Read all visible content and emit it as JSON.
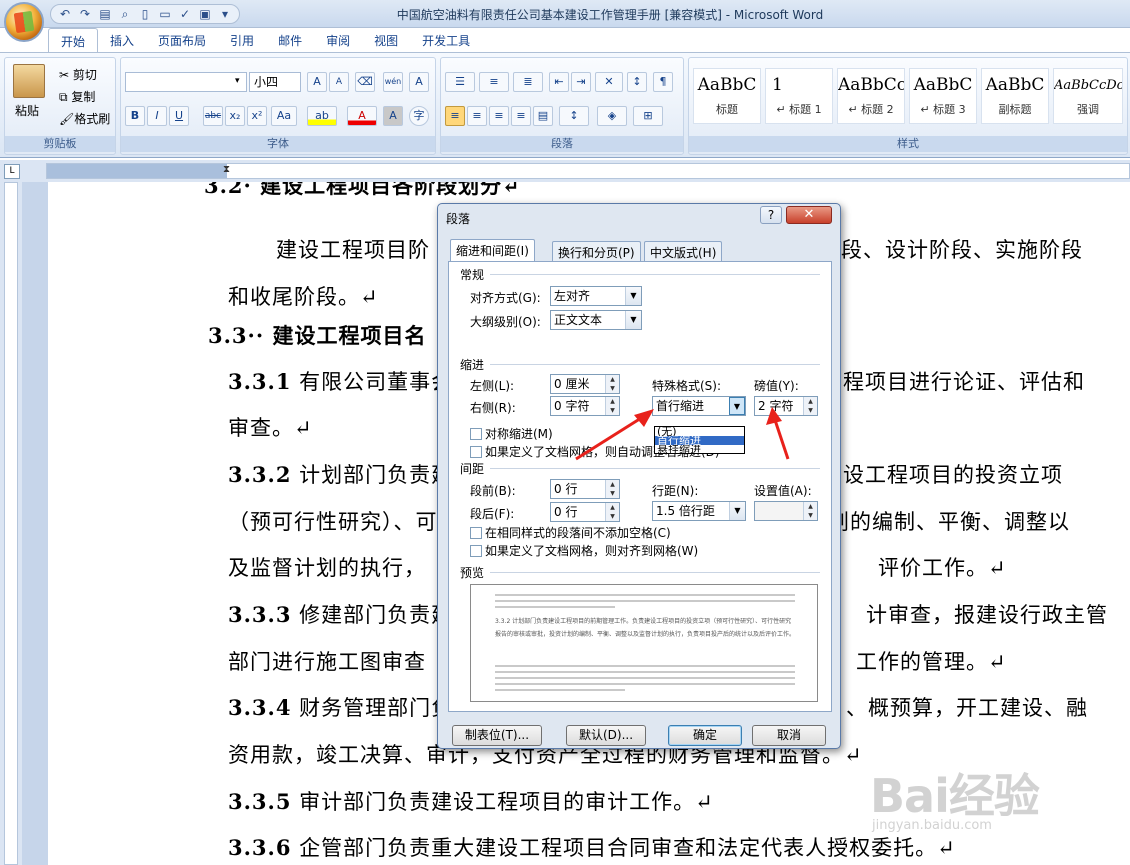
{
  "window": {
    "title": "中国航空油料有限责任公司基本建设工作管理手册 [兼容模式] - Microsoft Word",
    "qat_icons": [
      "undo-icon",
      "redo-icon",
      "print-icon",
      "preview-icon",
      "new-icon",
      "open-icon",
      "spell-icon",
      "save-icon"
    ]
  },
  "tabs": [
    "开始",
    "插入",
    "页面布局",
    "引用",
    "邮件",
    "审阅",
    "视图",
    "开发工具"
  ],
  "ribbon": {
    "clipboard": {
      "label": "剪贴板",
      "paste": "粘贴",
      "cut": "剪切",
      "copy": "复制",
      "format_painter": "格式刷"
    },
    "font": {
      "label": "字体",
      "font_name": "",
      "font_size": "小四",
      "bold": "B",
      "italic": "I",
      "underline": "U",
      "strike": "abc",
      "subscript": "x₂",
      "superscript": "x²",
      "case": "Aa",
      "grow": "A",
      "shrink": "A",
      "phonetic": "wén",
      "char_border": "A"
    },
    "paragraph": {
      "label": "段落"
    },
    "styles": {
      "label": "样式",
      "items": [
        {
          "preview": "AaBbC",
          "name": "标题"
        },
        {
          "preview": "1",
          "name": "↵ 标题 1"
        },
        {
          "preview": "AaBbCc",
          "name": "↵ 标题 2"
        },
        {
          "preview": "AaBbC",
          "name": "↵ 标题 3"
        },
        {
          "preview": "AaBbC",
          "name": "副标题"
        },
        {
          "preview": "AaBbCcDc",
          "name": "强调"
        }
      ]
    }
  },
  "document": {
    "heading_32": "3.2· 建设工程项目各阶段划分↵",
    "para_32_a": "建设工程项目阶",
    "para_32_b": "段、设计阶段、实施阶段",
    "para_32_c": "和收尾阶段。↵",
    "heading_33": "3.3·· 建设工程项目名",
    "items": [
      {
        "num": "3.3.1",
        "a": "有限公司董事会",
        "b": "程项目进行论证、评估和",
        "c": "审查。↵"
      },
      {
        "num": "3.3.2",
        "a": "计划部门负责建",
        "b": "设工程项目的投资立项",
        "c": "（预可行性研究）、可",
        "d": "划的编制、平衡、调整以",
        "e": "及监督计划的执行，",
        "f": "评价工作。↵"
      },
      {
        "num": "3.3.3",
        "a": "修建部门负责建",
        "b": "计审查，报建设行政主管",
        "c": "部门进行施工图审查",
        "d": "工作的管理。↵"
      },
      {
        "num": "3.3.4",
        "a": "财务管理部门负",
        "b": "、概预算，开工建设、融",
        "c": "资用款，竣工决算、审计，支付资产全过程的财务管理和监督。↵"
      },
      {
        "num": "3.3.5",
        "a": "审计部门负责建设工程项目的审计工作。↵"
      },
      {
        "num": "3.3.6",
        "a": "企管部门负责重大建设工程项目合同审查和法定代表人授权委托。↵"
      }
    ]
  },
  "dialog": {
    "title": "段落",
    "help": "?",
    "close": "✕",
    "tabs": [
      "缩进和间距(I)",
      "换行和分页(P)",
      "中文版式(H)"
    ],
    "general": {
      "section": "常规",
      "alignment_label": "对齐方式(G):",
      "alignment_value": "左对齐",
      "outline_label": "大纲级别(O):",
      "outline_value": "正文文本"
    },
    "indent": {
      "section": "缩进",
      "left_label": "左侧(L):",
      "left_value": "0 厘米",
      "right_label": "右侧(R):",
      "right_value": "0 字符",
      "special_label": "特殊格式(S):",
      "special_value": "首行缩进",
      "by_label": "磅值(Y):",
      "by_value": "2 字符",
      "mirror": "对称缩进(M)",
      "auto_adjust": "如果定义了文档网格，则自动调整右缩进(D)",
      "options": [
        "(无)",
        "首行缩进",
        "悬挂缩进"
      ],
      "selected_option": "首行缩进"
    },
    "spacing": {
      "section": "间距",
      "before_label": "段前(B):",
      "before_value": "0 行",
      "after_label": "段后(F):",
      "after_value": "0 行",
      "line_label": "行距(N):",
      "line_value": "1.5 倍行距",
      "at_label": "设置值(A):",
      "at_value": "",
      "no_space": "在相同样式的段落间不添加空格(C)",
      "snap_grid": "如果定义了文档网格，则对齐到网格(W)"
    },
    "preview": {
      "section": "预览",
      "sample_text": "3.3.2 计划部门负责建设工程项目的前期管理工作。负责建设工程项目的投资立项（预可行性研究）、可行性研究报告的审核或审批，投资计划的编制、平衡、调整以及监督计划的执行，负责项目投产后的统计以及后评价工作。"
    },
    "buttons": {
      "tabs": "制表位(T)...",
      "default": "默认(D)...",
      "ok": "确定",
      "cancel": "取消"
    }
  },
  "watermark": {
    "logo": "Bai经验",
    "url": "jingyan.baidu.com"
  },
  "colors": {
    "ribbon_text": "#15428b",
    "selection": "#316ac5",
    "annotation_arrow": "#e8211b"
  }
}
